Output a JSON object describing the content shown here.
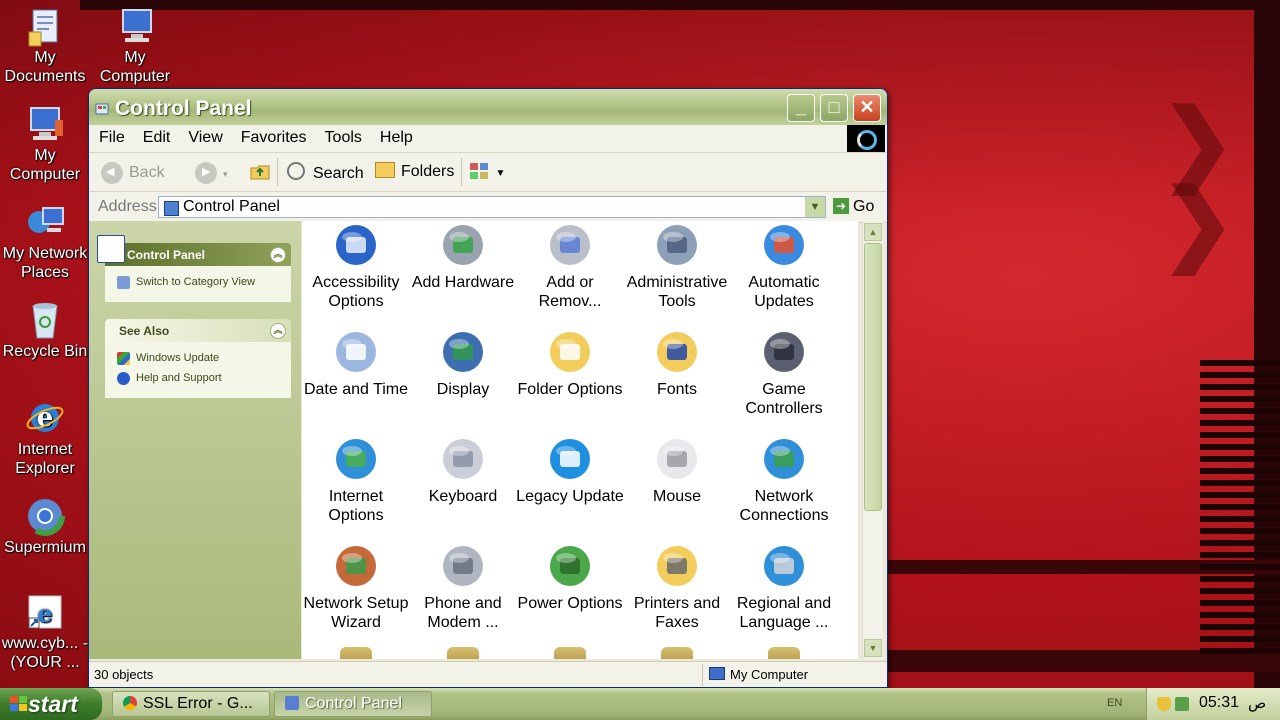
{
  "desktop": {
    "icons": [
      {
        "label": "My Documents"
      },
      {
        "label": "My Computer"
      },
      {
        "label": "My Computer"
      },
      {
        "label": "My Network Places"
      },
      {
        "label": "Recycle Bin"
      },
      {
        "label": "Internet Explorer"
      },
      {
        "label": "Supermium"
      },
      {
        "label": "www.cyb... - (YOUR ..."
      }
    ]
  },
  "window": {
    "title": "Control Panel",
    "menu": [
      "File",
      "Edit",
      "View",
      "Favorites",
      "Tools",
      "Help"
    ],
    "toolbar": {
      "back": "Back",
      "search": "Search",
      "folders": "Folders"
    },
    "address": {
      "label": "Address",
      "value": "Control Panel",
      "go": "Go"
    },
    "left_pane": {
      "control_panel": {
        "title": "Control Panel",
        "links": [
          "Switch to Category View"
        ]
      },
      "see_also": {
        "title": "See Also",
        "links": [
          "Windows Update",
          "Help and Support"
        ]
      }
    },
    "items": [
      {
        "label": "Accessibility Options",
        "icon": "accessibility-icon"
      },
      {
        "label": "Add Hardware",
        "icon": "add-hardware-icon"
      },
      {
        "label": "Add or Remov...",
        "icon": "add-remove-programs-icon"
      },
      {
        "label": "Administrative Tools",
        "icon": "administrative-tools-icon"
      },
      {
        "label": "Automatic Updates",
        "icon": "automatic-updates-icon"
      },
      {
        "label": "Date and Time",
        "icon": "date-time-icon"
      },
      {
        "label": "Display",
        "icon": "display-icon"
      },
      {
        "label": "Folder Options",
        "icon": "folder-options-icon"
      },
      {
        "label": "Fonts",
        "icon": "fonts-icon"
      },
      {
        "label": "Game Controllers",
        "icon": "game-controllers-icon"
      },
      {
        "label": "Internet Options",
        "icon": "internet-options-icon"
      },
      {
        "label": "Keyboard",
        "icon": "keyboard-icon"
      },
      {
        "label": "Legacy Update",
        "icon": "legacy-update-icon"
      },
      {
        "label": "Mouse",
        "icon": "mouse-icon"
      },
      {
        "label": "Network Connections",
        "icon": "network-connections-icon"
      },
      {
        "label": "Network Setup Wizard",
        "icon": "network-setup-icon"
      },
      {
        "label": "Phone and Modem ...",
        "icon": "phone-modem-icon"
      },
      {
        "label": "Power Options",
        "icon": "power-options-icon"
      },
      {
        "label": "Printers and Faxes",
        "icon": "printers-faxes-icon"
      },
      {
        "label": "Regional and Language ...",
        "icon": "regional-language-icon"
      }
    ],
    "status": {
      "count": "30 objects",
      "location": "My Computer"
    }
  },
  "taskbar": {
    "start": "start",
    "tasks": [
      {
        "label": "SSL Error - G...",
        "active": false
      },
      {
        "label": "Control Panel",
        "active": true
      }
    ],
    "language": "EN",
    "clock": "05:31",
    "ampm": "ص"
  },
  "colors": {
    "desktop_bg": "#b3141c",
    "title_bar": "#a3b878",
    "close_button": "#c8401e",
    "start_button": "#3e7d2b"
  }
}
